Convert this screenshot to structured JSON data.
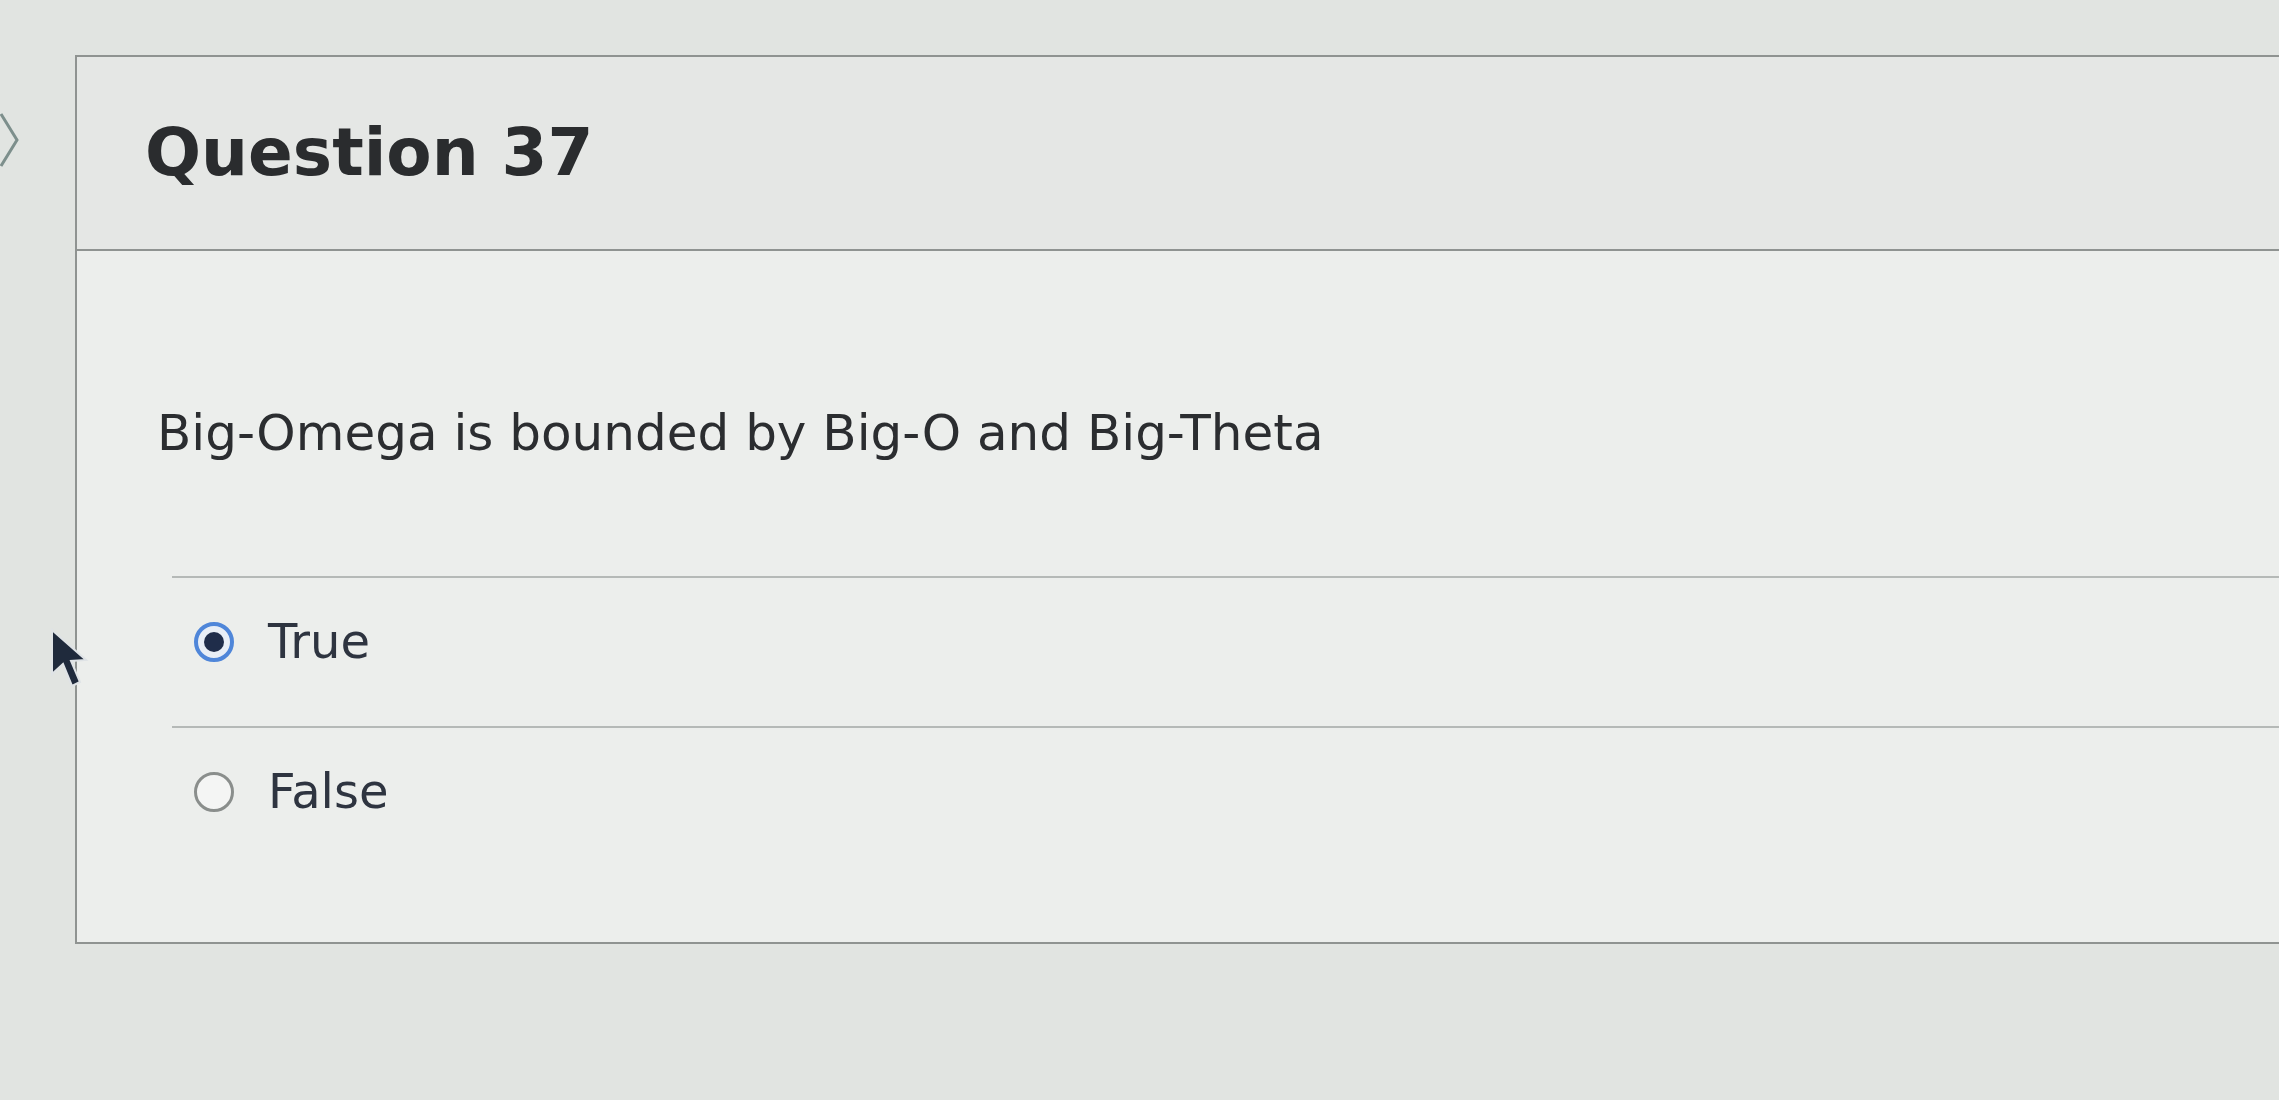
{
  "question": {
    "title": "Question 37",
    "text": "Big-Omega is bounded by Big-O and Big-Theta"
  },
  "options": [
    {
      "label": "True",
      "selected": true
    },
    {
      "label": "False",
      "selected": false
    }
  ]
}
